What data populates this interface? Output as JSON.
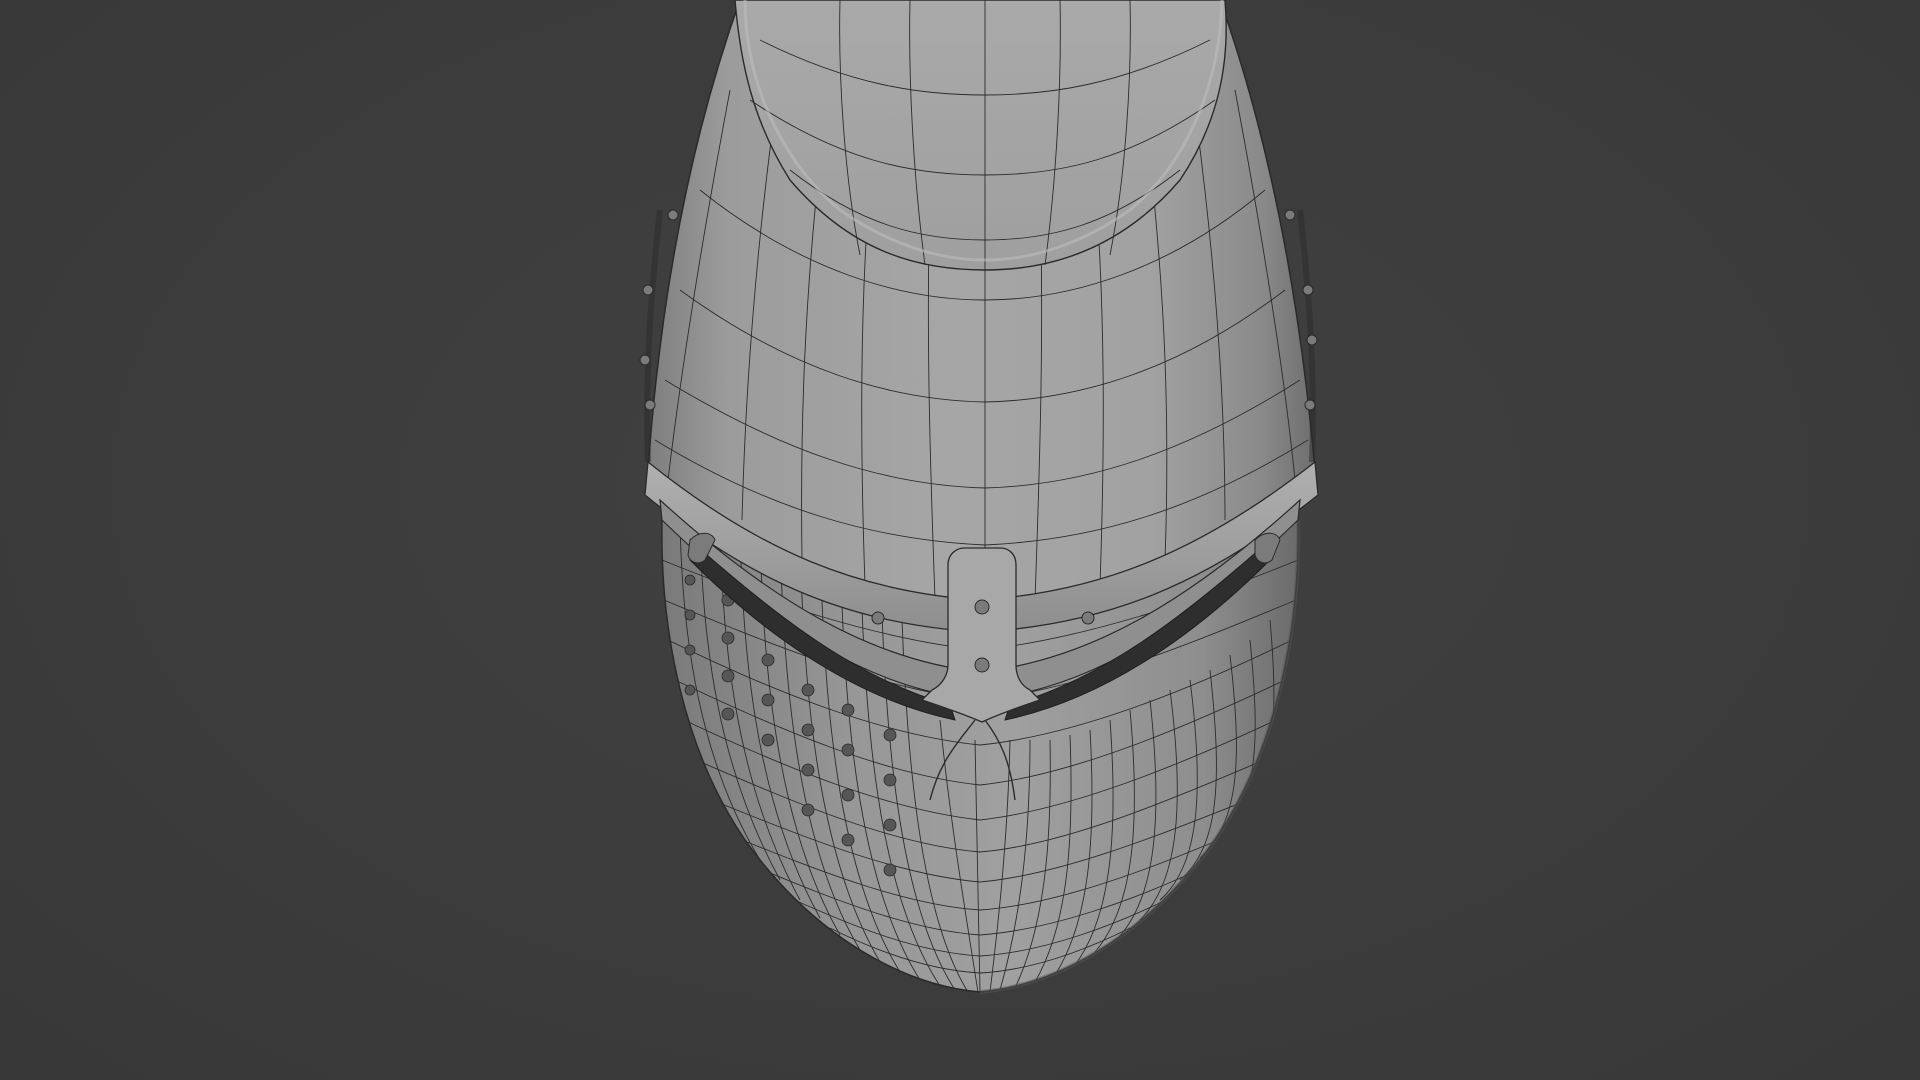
{
  "viewport": {
    "background_color": "#3c3c3c",
    "mesh_base_color": "#9a9a9a",
    "wire_color": "#2a2a2a"
  },
  "model": {
    "icon": "great-helm-wireframe-mesh"
  }
}
